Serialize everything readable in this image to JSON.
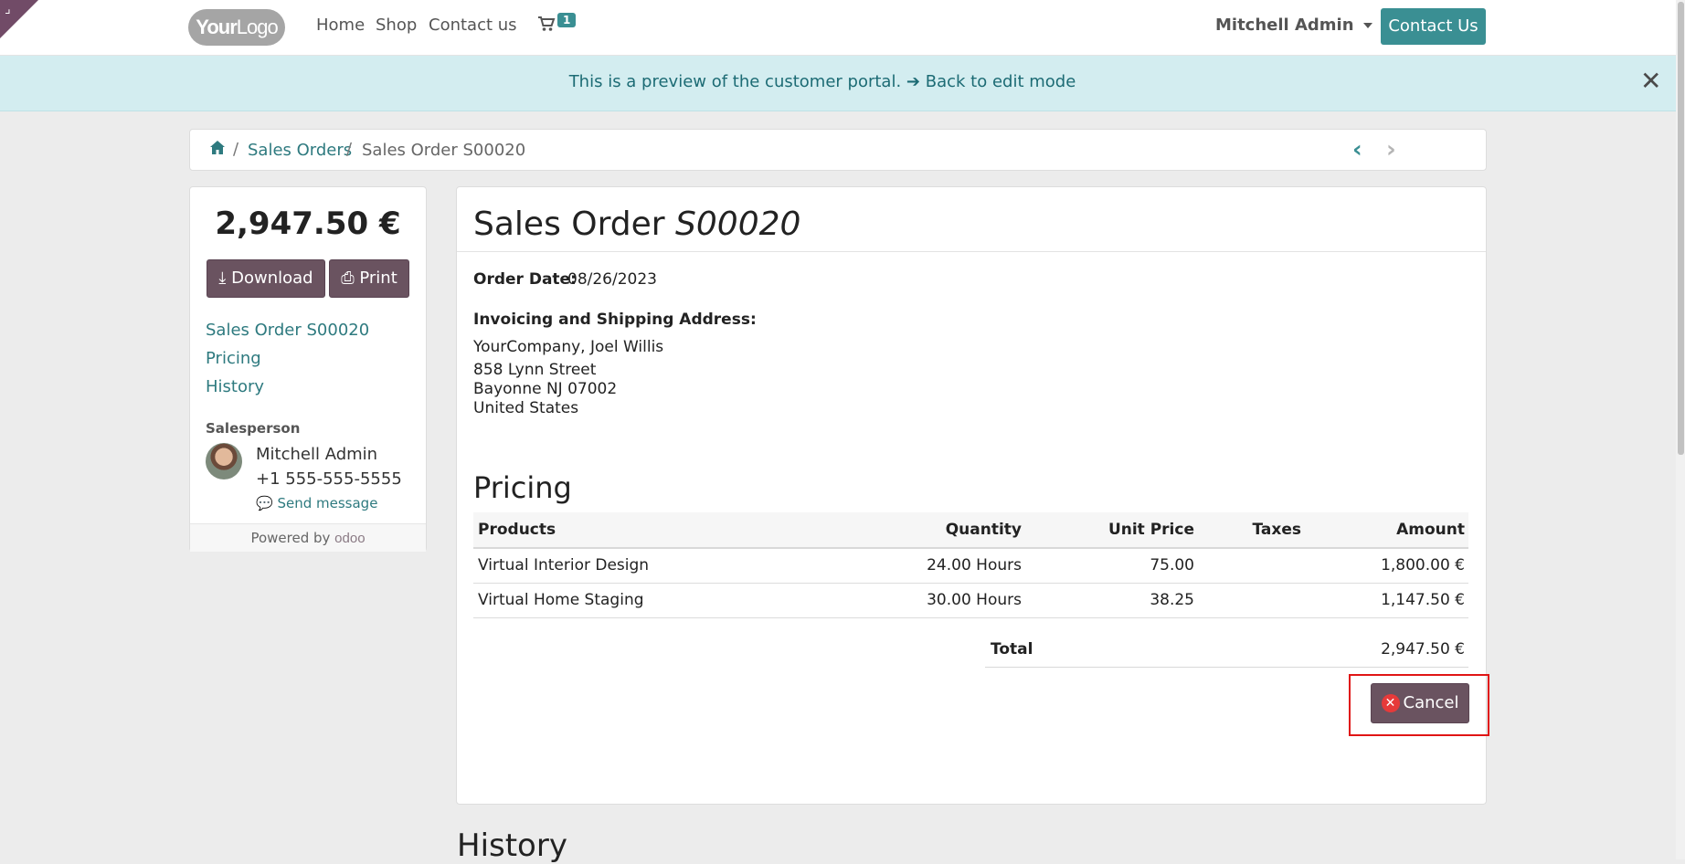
{
  "header": {
    "logo": {
      "bold": "Your",
      "rest": "Logo"
    },
    "nav": [
      "Home",
      "Shop",
      "Contact us"
    ],
    "cart_count": "1",
    "user_name": "Mitchell Admin",
    "contact_button": "Contact Us"
  },
  "banner": {
    "text": "This is a preview of the customer portal.",
    "back_link": "Back to edit mode",
    "arrow": "➔",
    "close": "✕"
  },
  "breadcrumb": {
    "home_icon": "⌂",
    "separator": "/",
    "link": "Sales Orders",
    "current": "Sales Order S00020",
    "prev": "‹",
    "next": "›"
  },
  "sidebar": {
    "amount": "2,947.50 €",
    "download_label": "Download",
    "print_label": "Print",
    "download_icon": "⤓",
    "print_icon": "⎙",
    "links": [
      "Sales Order S00020",
      "Pricing",
      "History"
    ],
    "salesperson_label": "Salesperson",
    "salesperson_name": "Mitchell Admin",
    "salesperson_phone": "+1 555-555-5555",
    "send_message": "Send message",
    "message_icon": "💬",
    "powered_by": "Powered by",
    "powered_brand": "odoo"
  },
  "order": {
    "title_prefix": "Sales Order",
    "title_ref": "S00020",
    "date_label": "Order Date:",
    "date": "08/26/2023",
    "address_label": "Invoicing and Shipping Address:",
    "address_lines": [
      "YourCompany, Joel Willis",
      "858 Lynn Street",
      "Bayonne NJ 07002",
      "United States"
    ],
    "pricing_heading": "Pricing",
    "columns": [
      "Products",
      "Quantity",
      "Unit Price",
      "Taxes",
      "Amount"
    ],
    "lines": [
      {
        "product": "Virtual Interior Design",
        "quantity": "24.00 Hours",
        "unit_price": "75.00",
        "taxes": "",
        "amount": "1,800.00 €"
      },
      {
        "product": "Virtual Home Staging",
        "quantity": "30.00 Hours",
        "unit_price": "38.25",
        "taxes": "",
        "amount": "1,147.50 €"
      }
    ],
    "total_label": "Total",
    "total": "2,947.50 €",
    "cancel_label": "Cancel",
    "cancel_icon": "✕"
  },
  "history_heading": "History",
  "colors": {
    "accent": "#3a8f93",
    "dark_button": "#6a5360",
    "banner_bg": "#d3edf0",
    "highlight": "#e01515"
  }
}
